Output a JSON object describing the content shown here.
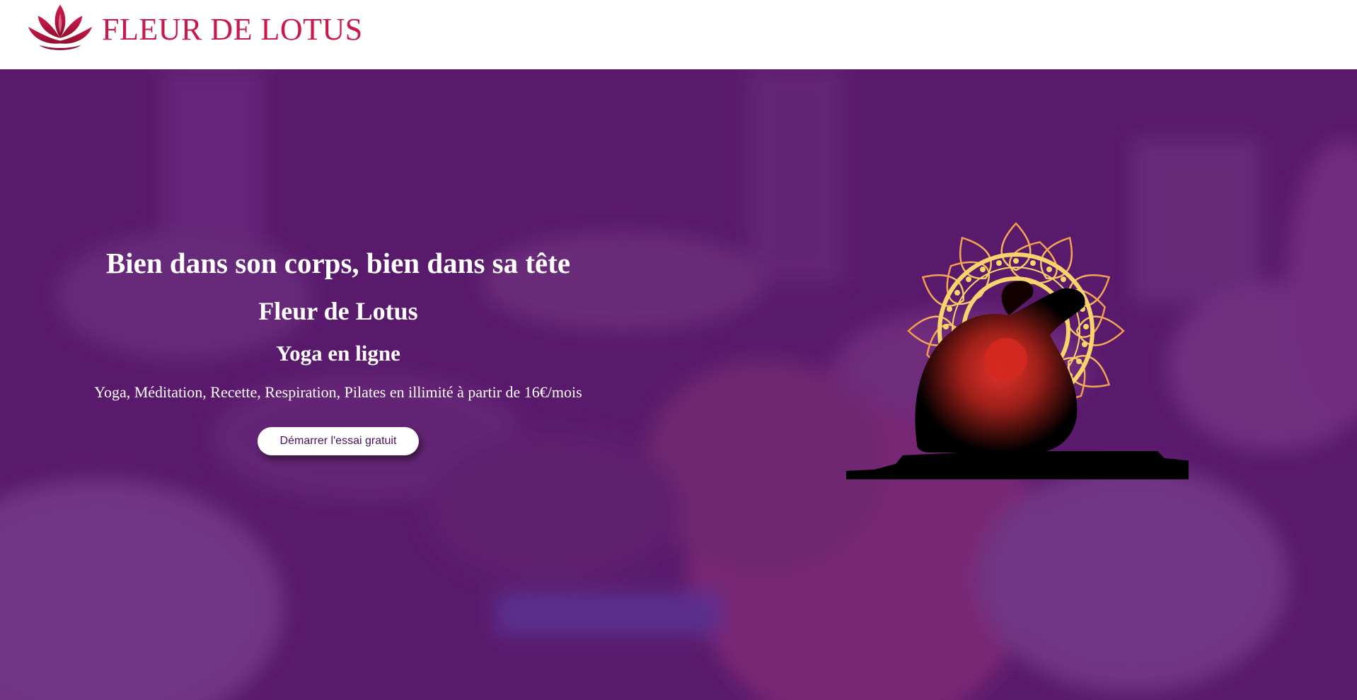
{
  "header": {
    "logo_text": "FLEUR DE LOTUS",
    "logo_icon": "lotus-icon",
    "brand_color": "#c8194a"
  },
  "hero": {
    "headline": "Bien dans son corps, bien dans sa tête",
    "brand_name": "Fleur de Lotus",
    "subtitle": "Yoga en ligne",
    "tagline": "Yoga, Méditation, Recette, Respiration, Pilates en illimité à partir de 16€/mois",
    "cta_label": "Démarrer l'essai gratuit",
    "overlay_color": "#5c1c6e",
    "illustration": "yoga-mandala-silhouette"
  }
}
